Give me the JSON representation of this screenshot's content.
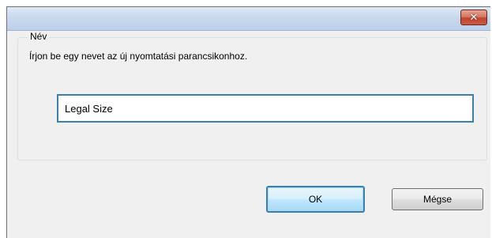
{
  "dialog": {
    "close_symbol": "✕",
    "group_label": "Név",
    "instruction": "Írjon be egy nevet az új nyomtatási parancsikonhoz.",
    "name_value": "Legal Size",
    "ok_label": "OK",
    "cancel_label": "Mégse"
  },
  "colors": {
    "focus_border": "#3c7fb1",
    "close_button": "#c0432e",
    "dialog_background": "#f0f0f0"
  },
  "icons": {
    "close": "close-icon"
  }
}
